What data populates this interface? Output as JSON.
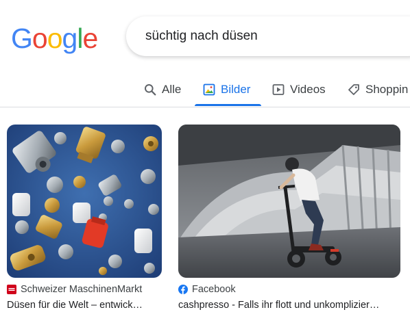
{
  "logo": {
    "letters": [
      "G",
      "o",
      "o",
      "g",
      "l",
      "e"
    ],
    "colors": [
      "#4285F4",
      "#EA4335",
      "#FBBC05",
      "#4285F4",
      "#34A853",
      "#EA4335"
    ]
  },
  "search": {
    "query": "süchtig nach düsen"
  },
  "tabs": [
    {
      "label": "Alle",
      "icon": "search-icon",
      "active": false
    },
    {
      "label": "Bilder",
      "icon": "image-icon",
      "active": true
    },
    {
      "label": "Videos",
      "icon": "video-icon",
      "active": false
    },
    {
      "label": "Shoppin",
      "icon": "tag-icon",
      "active": false
    }
  ],
  "results": [
    {
      "source": "Schweizer MaschinenMarkt",
      "source_icon": "maschinenmarkt-favicon",
      "caption": "Düsen für die Welt – entwick…",
      "image": "assorted metal and plastic nozzles on blue background"
    },
    {
      "source": "Facebook",
      "source_icon": "facebook-icon",
      "caption": "cashpresso - Falls ihr flott und unkomplizier…",
      "image": "person riding an electric scooter under a bridge"
    }
  ],
  "colors": {
    "accent": "#1a73e8",
    "tab_text": "#3c4043",
    "divider": "#dadce0",
    "facebook": "#1877f2",
    "mm_red": "#d0021b"
  }
}
